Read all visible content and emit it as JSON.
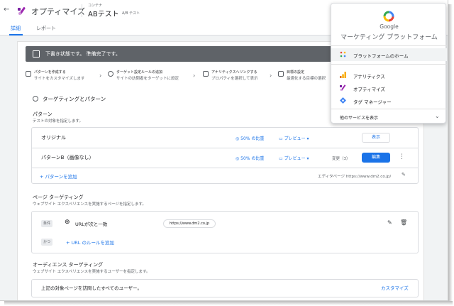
{
  "header": {
    "app_title": "オプティマイズ",
    "container_label": "コンテナ",
    "experiment_name": "ABテスト",
    "experiment_type": "A/B テスト"
  },
  "tabs": [
    {
      "label": "詳細",
      "active": true
    },
    {
      "label": "レポート",
      "active": false
    }
  ],
  "status": {
    "text": "下書き状態です。  準備完了です。"
  },
  "steps": [
    {
      "title": "パターンを作成する",
      "desc": "サイトをカスタマイズします"
    },
    {
      "title": "ターゲット設定ルールの追加",
      "desc": "サイトの訪問者をターゲットに設定"
    },
    {
      "title": "アナリティクスへリンクする",
      "desc": "プロパティを選択して表示"
    },
    {
      "title": "目標の設定",
      "desc": "最適化する目標の選択"
    }
  ],
  "targeting": {
    "section_title": "ターゲティングとパターン",
    "variants_title": "パターン",
    "variants_desc": "テストの対象を指定します。",
    "variants": [
      {
        "name": "オリジナル",
        "ratio": "50% の比重",
        "preview": "プレビュー ▾",
        "action": "表示",
        "changes": ""
      },
      {
        "name": "パターンB（画像なし）",
        "ratio": "50% の比重",
        "preview": "プレビュー ▾",
        "action": "編集",
        "changes": "変更（3）"
      }
    ],
    "add_variant": "+ パターンを追加",
    "editor_page": "エディタページ https://www.dm2.co.jp/"
  },
  "page_targeting": {
    "title": "ページ ターゲティング",
    "desc": "ウェブサイト エクスペリエンスを実施するページを指定します。",
    "condition_chip": "条件",
    "rule_label": "URLが次と一致",
    "rule_value": "https://www.dm2.co.jp",
    "and_chip": "かつ",
    "add_rule": "+ URL のルールを追加"
  },
  "audience": {
    "title": "オーディエンス ターゲティング",
    "desc": "ウェブサイト エクスペリエンスを実施するユーザーを指定します。",
    "text": "上記の対象ページを訪問したすべてのユーザー。",
    "customize": "カスタマイズ"
  },
  "platform_panel": {
    "brand": "Google",
    "platform": "マーケティング プラットフォーム",
    "home": "プラットフォームのホーム",
    "items": [
      {
        "label": "アナリティクス",
        "icon": "analytics-icon"
      },
      {
        "label": "オプティマイズ",
        "icon": "optimize-icon"
      },
      {
        "label": "タグ マネージャー",
        "icon": "tag-manager-icon"
      }
    ],
    "more": "他のサービスを表示"
  }
}
